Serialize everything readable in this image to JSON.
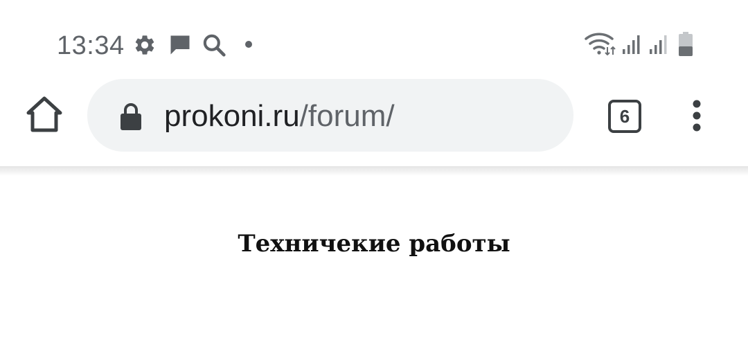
{
  "status_bar": {
    "time": "13:34",
    "left_icons": [
      "gear-icon",
      "chat-icon",
      "search-icon",
      "notification-dot-icon"
    ],
    "right_icons": [
      "wifi-icon",
      "signal-icon",
      "signal-icon",
      "battery-icon"
    ]
  },
  "toolbar": {
    "home_icon": "home-icon",
    "lock_icon": "lock-icon",
    "url_host": "prokoni.ru",
    "url_path": "/forum/",
    "tab_count": "6",
    "menu_icon": "more-vert-icon"
  },
  "page": {
    "heading": "Техничекие работы"
  },
  "colors": {
    "status_text": "#5f6368",
    "omnibox_bg": "#f1f3f4",
    "icon": "#3c4043"
  }
}
